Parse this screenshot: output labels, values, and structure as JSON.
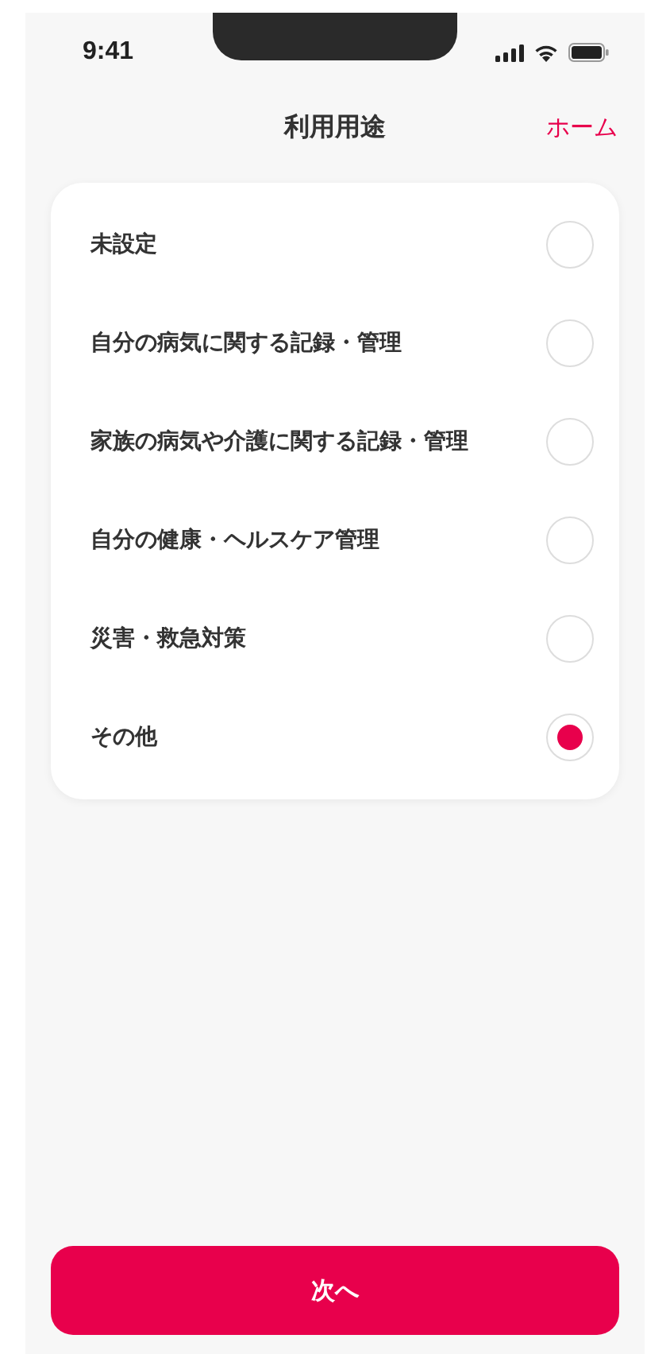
{
  "status_bar": {
    "time": "9:41"
  },
  "header": {
    "title": "利用用途",
    "action": "ホーム"
  },
  "options": [
    {
      "label": "未設定",
      "selected": false
    },
    {
      "label": "自分の病気に関する記録・管理",
      "selected": false
    },
    {
      "label": "家族の病気や介護に関する記録・管理",
      "selected": false
    },
    {
      "label": "自分の健康・ヘルスケア管理",
      "selected": false
    },
    {
      "label": "災害・救急対策",
      "selected": false
    },
    {
      "label": "その他",
      "selected": true
    }
  ],
  "next_button": "次へ"
}
